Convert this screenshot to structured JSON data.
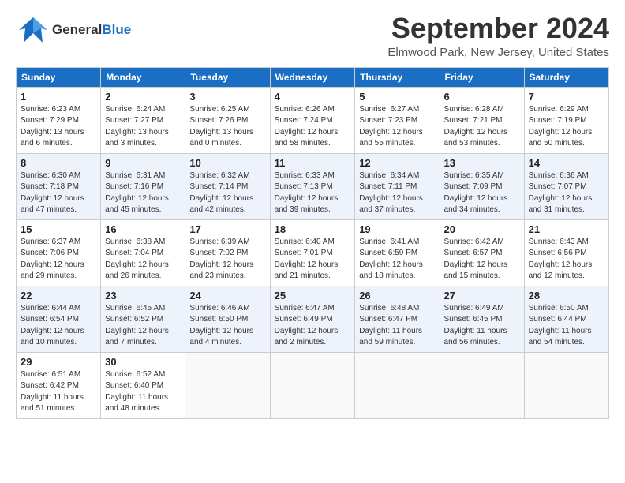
{
  "header": {
    "logo_general": "General",
    "logo_blue": "Blue",
    "month_title": "September 2024",
    "location": "Elmwood Park, New Jersey, United States"
  },
  "days_of_week": [
    "Sunday",
    "Monday",
    "Tuesday",
    "Wednesday",
    "Thursday",
    "Friday",
    "Saturday"
  ],
  "weeks": [
    [
      {
        "day": "1",
        "sunrise": "6:23 AM",
        "sunset": "7:29 PM",
        "daylight": "13 hours and 6 minutes."
      },
      {
        "day": "2",
        "sunrise": "6:24 AM",
        "sunset": "7:27 PM",
        "daylight": "13 hours and 3 minutes."
      },
      {
        "day": "3",
        "sunrise": "6:25 AM",
        "sunset": "7:26 PM",
        "daylight": "13 hours and 0 minutes."
      },
      {
        "day": "4",
        "sunrise": "6:26 AM",
        "sunset": "7:24 PM",
        "daylight": "12 hours and 58 minutes."
      },
      {
        "day": "5",
        "sunrise": "6:27 AM",
        "sunset": "7:23 PM",
        "daylight": "12 hours and 55 minutes."
      },
      {
        "day": "6",
        "sunrise": "6:28 AM",
        "sunset": "7:21 PM",
        "daylight": "12 hours and 53 minutes."
      },
      {
        "day": "7",
        "sunrise": "6:29 AM",
        "sunset": "7:19 PM",
        "daylight": "12 hours and 50 minutes."
      }
    ],
    [
      {
        "day": "8",
        "sunrise": "6:30 AM",
        "sunset": "7:18 PM",
        "daylight": "12 hours and 47 minutes."
      },
      {
        "day": "9",
        "sunrise": "6:31 AM",
        "sunset": "7:16 PM",
        "daylight": "12 hours and 45 minutes."
      },
      {
        "day": "10",
        "sunrise": "6:32 AM",
        "sunset": "7:14 PM",
        "daylight": "12 hours and 42 minutes."
      },
      {
        "day": "11",
        "sunrise": "6:33 AM",
        "sunset": "7:13 PM",
        "daylight": "12 hours and 39 minutes."
      },
      {
        "day": "12",
        "sunrise": "6:34 AM",
        "sunset": "7:11 PM",
        "daylight": "12 hours and 37 minutes."
      },
      {
        "day": "13",
        "sunrise": "6:35 AM",
        "sunset": "7:09 PM",
        "daylight": "12 hours and 34 minutes."
      },
      {
        "day": "14",
        "sunrise": "6:36 AM",
        "sunset": "7:07 PM",
        "daylight": "12 hours and 31 minutes."
      }
    ],
    [
      {
        "day": "15",
        "sunrise": "6:37 AM",
        "sunset": "7:06 PM",
        "daylight": "12 hours and 29 minutes."
      },
      {
        "day": "16",
        "sunrise": "6:38 AM",
        "sunset": "7:04 PM",
        "daylight": "12 hours and 26 minutes."
      },
      {
        "day": "17",
        "sunrise": "6:39 AM",
        "sunset": "7:02 PM",
        "daylight": "12 hours and 23 minutes."
      },
      {
        "day": "18",
        "sunrise": "6:40 AM",
        "sunset": "7:01 PM",
        "daylight": "12 hours and 21 minutes."
      },
      {
        "day": "19",
        "sunrise": "6:41 AM",
        "sunset": "6:59 PM",
        "daylight": "12 hours and 18 minutes."
      },
      {
        "day": "20",
        "sunrise": "6:42 AM",
        "sunset": "6:57 PM",
        "daylight": "12 hours and 15 minutes."
      },
      {
        "day": "21",
        "sunrise": "6:43 AM",
        "sunset": "6:56 PM",
        "daylight": "12 hours and 12 minutes."
      }
    ],
    [
      {
        "day": "22",
        "sunrise": "6:44 AM",
        "sunset": "6:54 PM",
        "daylight": "12 hours and 10 minutes."
      },
      {
        "day": "23",
        "sunrise": "6:45 AM",
        "sunset": "6:52 PM",
        "daylight": "12 hours and 7 minutes."
      },
      {
        "day": "24",
        "sunrise": "6:46 AM",
        "sunset": "6:50 PM",
        "daylight": "12 hours and 4 minutes."
      },
      {
        "day": "25",
        "sunrise": "6:47 AM",
        "sunset": "6:49 PM",
        "daylight": "12 hours and 2 minutes."
      },
      {
        "day": "26",
        "sunrise": "6:48 AM",
        "sunset": "6:47 PM",
        "daylight": "11 hours and 59 minutes."
      },
      {
        "day": "27",
        "sunrise": "6:49 AM",
        "sunset": "6:45 PM",
        "daylight": "11 hours and 56 minutes."
      },
      {
        "day": "28",
        "sunrise": "6:50 AM",
        "sunset": "6:44 PM",
        "daylight": "11 hours and 54 minutes."
      }
    ],
    [
      {
        "day": "29",
        "sunrise": "6:51 AM",
        "sunset": "6:42 PM",
        "daylight": "11 hours and 51 minutes."
      },
      {
        "day": "30",
        "sunrise": "6:52 AM",
        "sunset": "6:40 PM",
        "daylight": "11 hours and 48 minutes."
      },
      null,
      null,
      null,
      null,
      null
    ]
  ],
  "labels": {
    "sunrise": "Sunrise:",
    "sunset": "Sunset:",
    "daylight": "Daylight:"
  }
}
